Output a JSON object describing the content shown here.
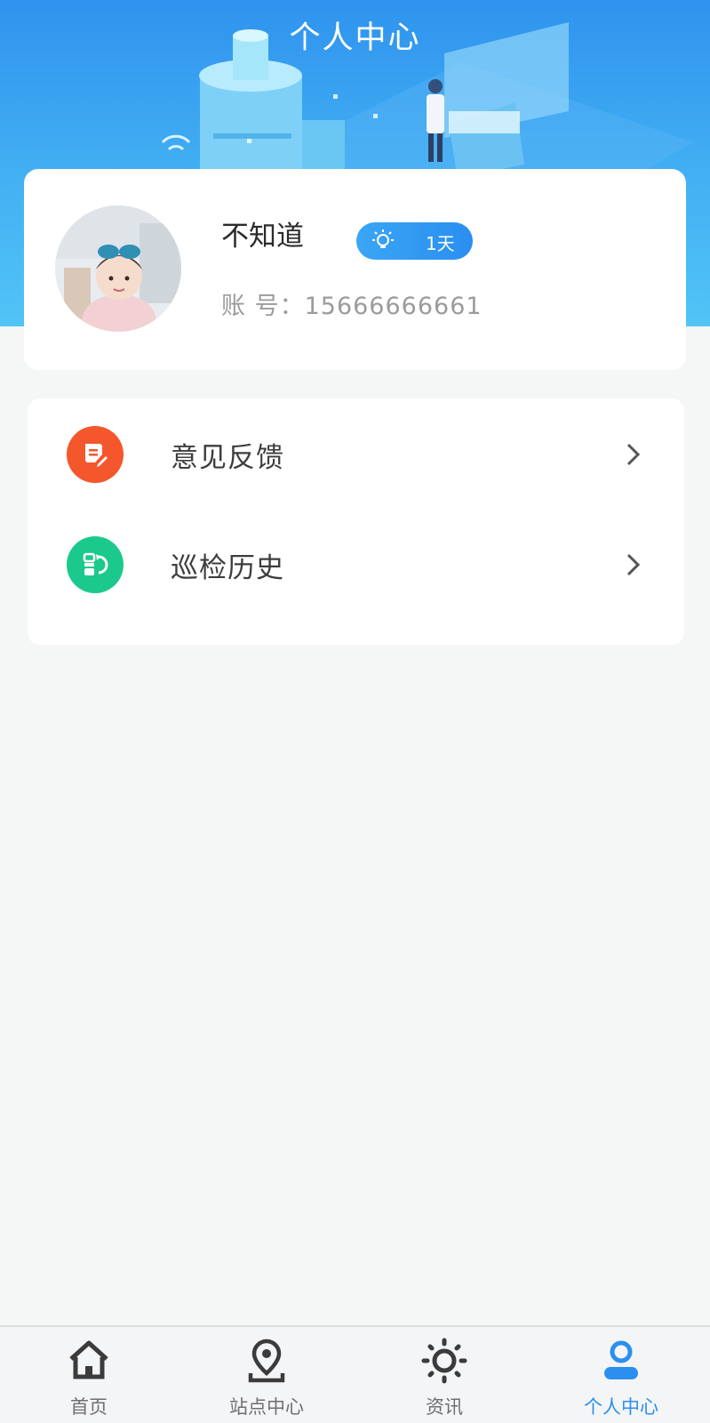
{
  "header": {
    "title": "个人中心"
  },
  "profile": {
    "name": "不知道",
    "days_badge": "1天",
    "account_label": "账 号：",
    "account_value": "15666666661"
  },
  "menu": [
    {
      "label": "意见反馈",
      "icon": "feedback-document-icon",
      "icon_bg": "#f4572c"
    },
    {
      "label": "巡检历史",
      "icon": "inspection-history-icon",
      "icon_bg": "#1cc98c"
    }
  ],
  "tabbar": {
    "items": [
      {
        "label": "首页",
        "icon": "home-icon"
      },
      {
        "label": "站点中心",
        "icon": "location-pin-icon"
      },
      {
        "label": "资讯",
        "icon": "sun-news-icon"
      },
      {
        "label": "个人中心",
        "icon": "user-icon"
      }
    ],
    "active_index": 3,
    "active_color": "#2b8fef",
    "inactive_color": "#3b3b3b"
  },
  "colors": {
    "header_blue": "#2f93ee",
    "page_bg": "#f5f6f6"
  }
}
